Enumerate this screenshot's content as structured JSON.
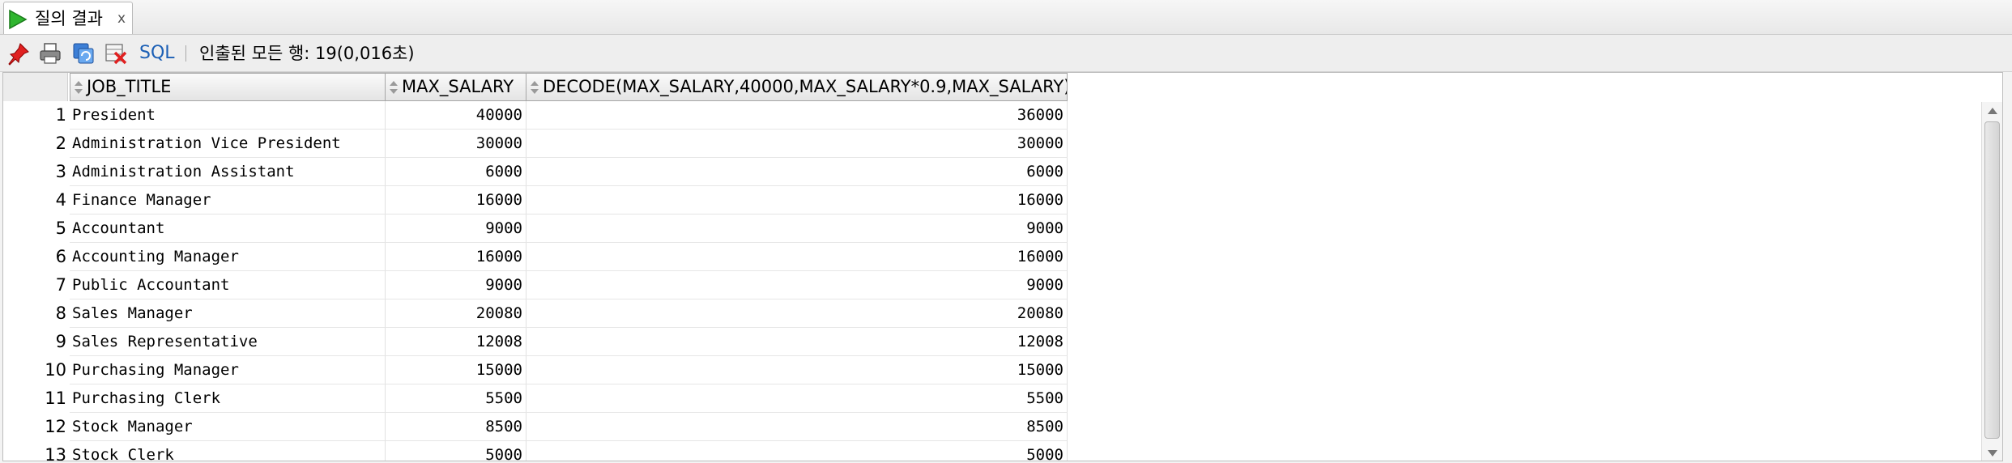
{
  "tab": {
    "title": "질의 결과",
    "close": "x"
  },
  "toolbar": {
    "sql_label": "SQL",
    "status": "인출된 모든 행: 19(0,016초)"
  },
  "grid": {
    "columns": [
      "JOB_TITLE",
      "MAX_SALARY",
      "DECODE(MAX_SALARY,40000,MAX_SALARY*0.9,MAX_SALARY)"
    ],
    "rows": [
      {
        "n": "1",
        "job": "President",
        "max": "40000",
        "dec": "36000"
      },
      {
        "n": "2",
        "job": "Administration Vice President",
        "max": "30000",
        "dec": "30000"
      },
      {
        "n": "3",
        "job": "Administration Assistant",
        "max": "6000",
        "dec": "6000"
      },
      {
        "n": "4",
        "job": "Finance Manager",
        "max": "16000",
        "dec": "16000"
      },
      {
        "n": "5",
        "job": "Accountant",
        "max": "9000",
        "dec": "9000"
      },
      {
        "n": "6",
        "job": "Accounting Manager",
        "max": "16000",
        "dec": "16000"
      },
      {
        "n": "7",
        "job": "Public Accountant",
        "max": "9000",
        "dec": "9000"
      },
      {
        "n": "8",
        "job": "Sales Manager",
        "max": "20080",
        "dec": "20080"
      },
      {
        "n": "9",
        "job": "Sales Representative",
        "max": "12008",
        "dec": "12008"
      },
      {
        "n": "10",
        "job": "Purchasing Manager",
        "max": "15000",
        "dec": "15000"
      },
      {
        "n": "11",
        "job": "Purchasing Clerk",
        "max": "5500",
        "dec": "5500"
      },
      {
        "n": "12",
        "job": "Stock Manager",
        "max": "8500",
        "dec": "8500"
      },
      {
        "n": "13",
        "job": "Stock Clerk",
        "max": "5000",
        "dec": "5000"
      }
    ]
  },
  "icons": {
    "tab": "run-icon",
    "toolbar": [
      "pin-icon",
      "print-icon",
      "refresh-icon",
      "delete-icon"
    ],
    "accent": "#1b5fb5"
  }
}
